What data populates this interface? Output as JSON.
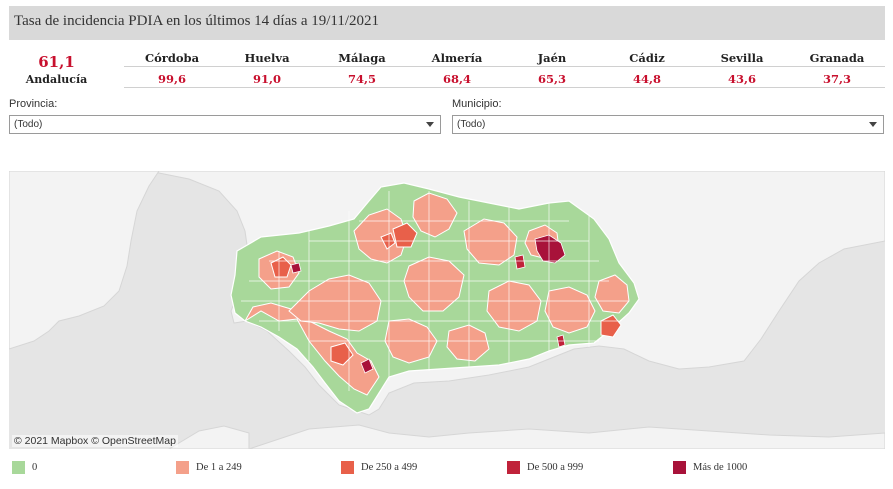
{
  "title": "Tasa de incidencia PDIA en los últimos 14 días a 19/11/2021",
  "region": {
    "name": "Andalucía",
    "value": "61,1"
  },
  "provinces": [
    {
      "name": "Córdoba",
      "value": "99,6"
    },
    {
      "name": "Huelva",
      "value": "91,0"
    },
    {
      "name": "Málaga",
      "value": "74,5"
    },
    {
      "name": "Almería",
      "value": "68,4"
    },
    {
      "name": "Jaén",
      "value": "65,3"
    },
    {
      "name": "Cádiz",
      "value": "44,8"
    },
    {
      "name": "Sevilla",
      "value": "43,6"
    },
    {
      "name": "Granada",
      "value": "37,3"
    }
  ],
  "filters": {
    "provincia": {
      "label": "Provincia:",
      "value": "(Todo)"
    },
    "municipio": {
      "label": "Municipio:",
      "value": "(Todo)"
    }
  },
  "map": {
    "attribution": "© 2021 Mapbox  © OpenStreetMap"
  },
  "legend": [
    {
      "label": "0",
      "color": "#a8d89a"
    },
    {
      "label": "De 1 a 249",
      "color": "#f4a08a"
    },
    {
      "label": "De 250 a 499",
      "color": "#e8604a"
    },
    {
      "label": "De 500 a 999",
      "color": "#c0223a"
    },
    {
      "label": "Más de 1000",
      "color": "#a8123a"
    }
  ],
  "colors": {
    "accent": "#c8102e",
    "land": "#f2f2f2",
    "sea": "#e5e5e5",
    "green": "#a8d89a",
    "salmon": "#f4a08a",
    "red": "#e8604a",
    "crimson": "#c0223a"
  }
}
